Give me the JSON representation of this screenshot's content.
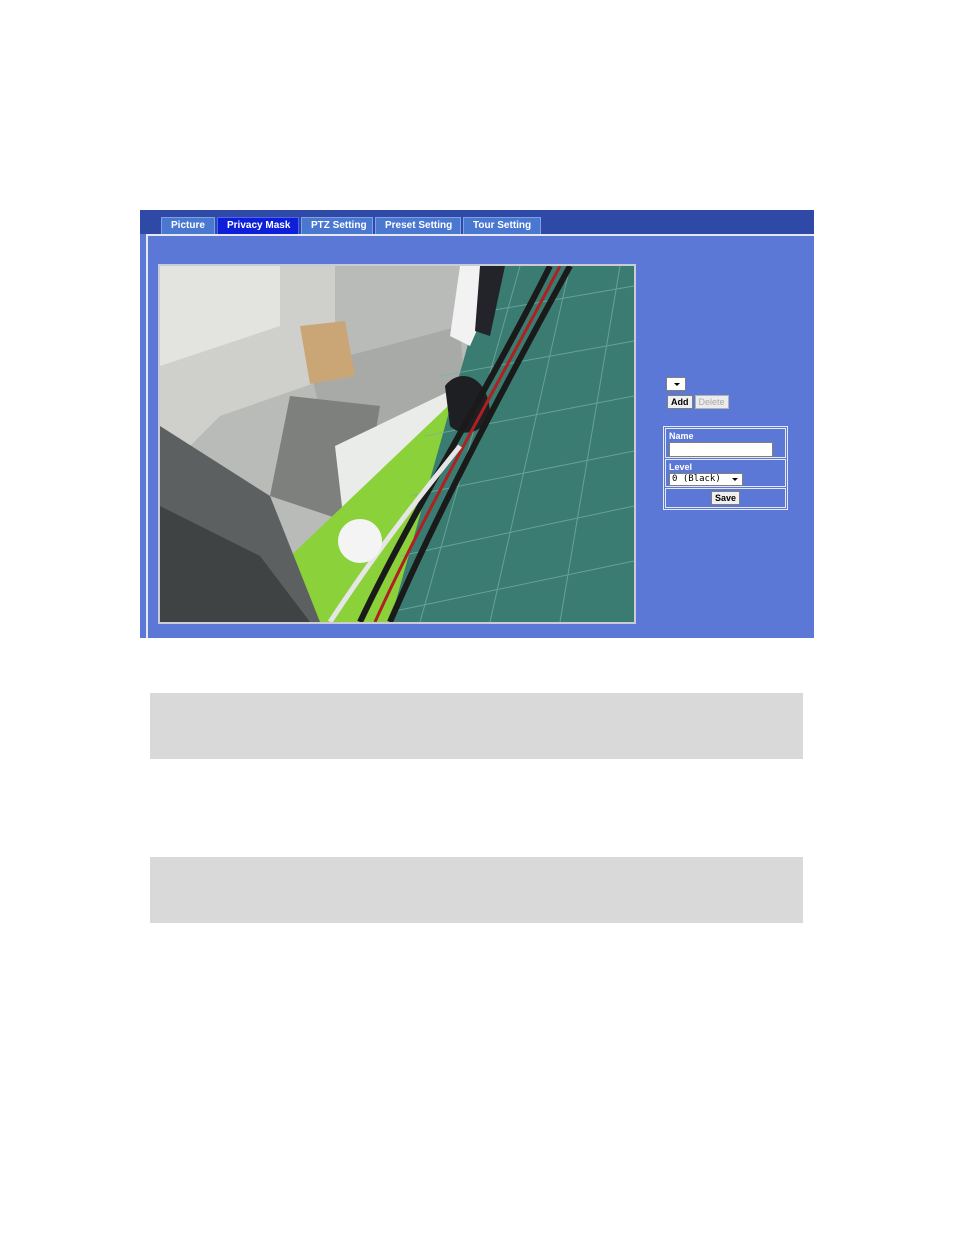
{
  "tabs": [
    {
      "label": "Picture",
      "active": false
    },
    {
      "label": "Privacy Mask",
      "active": true
    },
    {
      "label": "PTZ Setting",
      "active": false
    },
    {
      "label": "Preset Setting",
      "active": false
    },
    {
      "label": "Tour Setting",
      "active": false
    }
  ],
  "privacy_mask": {
    "mask_select_value": "",
    "add_label": "Add",
    "delete_label": "Delete",
    "name_label": "Name",
    "name_value": "",
    "level_label": "Level",
    "level_value": "0 (Black)",
    "save_label": "Save"
  },
  "colors": {
    "tab_bar": "#2e49a6",
    "panel_background": "#5b78d6",
    "active_tab": "#0d1fd8",
    "inactive_tab": "#4a78d0",
    "note_box": "#d9d9d9"
  }
}
